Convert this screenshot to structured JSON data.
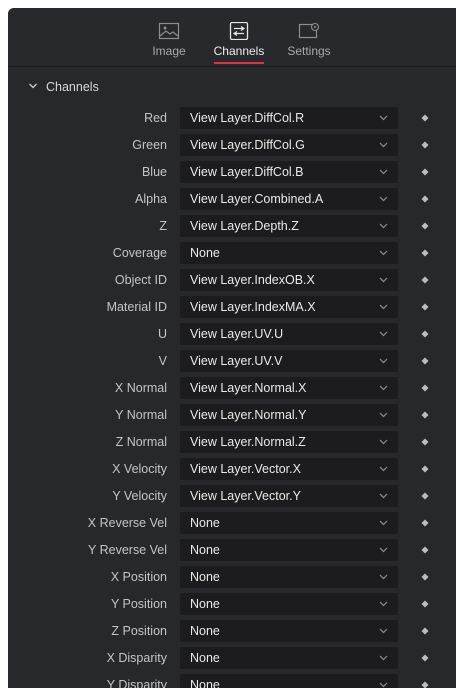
{
  "tabs": [
    {
      "label": "Image",
      "icon": "image-icon",
      "active": false
    },
    {
      "label": "Channels",
      "icon": "channels-icon",
      "active": true
    },
    {
      "label": "Settings",
      "icon": "settings-icon",
      "active": false
    }
  ],
  "section": {
    "title": "Channels",
    "icon": "chevron-down-icon"
  },
  "rows": [
    {
      "label": "Red",
      "value": "View Layer.DiffCol.R"
    },
    {
      "label": "Green",
      "value": "View Layer.DiffCol.G"
    },
    {
      "label": "Blue",
      "value": "View Layer.DiffCol.B"
    },
    {
      "label": "Alpha",
      "value": "View Layer.Combined.A"
    },
    {
      "label": "Z",
      "value": "View Layer.Depth.Z"
    },
    {
      "label": "Coverage",
      "value": "None"
    },
    {
      "label": "Object ID",
      "value": "View Layer.IndexOB.X"
    },
    {
      "label": "Material ID",
      "value": "View Layer.IndexMA.X"
    },
    {
      "label": "U",
      "value": "View Layer.UV.U"
    },
    {
      "label": "V",
      "value": "View Layer.UV.V"
    },
    {
      "label": "X Normal",
      "value": "View Layer.Normal.X"
    },
    {
      "label": "Y Normal",
      "value": "View Layer.Normal.Y"
    },
    {
      "label": "Z Normal",
      "value": "View Layer.Normal.Z"
    },
    {
      "label": "X Velocity",
      "value": "View Layer.Vector.X"
    },
    {
      "label": "Y Velocity",
      "value": "View Layer.Vector.Y"
    },
    {
      "label": "X Reverse Vel",
      "value": "None"
    },
    {
      "label": "Y Reverse Vel",
      "value": "None"
    },
    {
      "label": "X Position",
      "value": "None"
    },
    {
      "label": "Y Position",
      "value": "None"
    },
    {
      "label": "Z Position",
      "value": "None"
    },
    {
      "label": "X Disparity",
      "value": "None"
    },
    {
      "label": "Y Disparity",
      "value": "None"
    }
  ],
  "colors": {
    "panel_bg": "#27282b",
    "dropdown_bg": "#1c1c1e",
    "active_tab_underline": "#e2304a",
    "label_text": "#c4c5c8",
    "value_text": "#e9e9e9"
  }
}
